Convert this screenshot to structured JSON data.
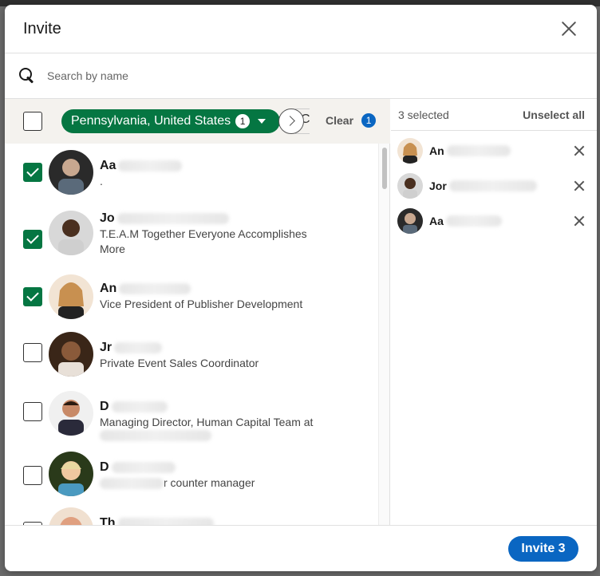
{
  "modal": {
    "title": "Invite"
  },
  "search": {
    "placeholder": "Search by name",
    "value": ""
  },
  "filter": {
    "location_label": "Pennsylvania, United States",
    "location_count": "1",
    "partial_label": "C",
    "clear_label": "Clear",
    "clear_count": "1"
  },
  "people": [
    {
      "name_visible": "Aa",
      "headline": ".",
      "checked": true,
      "avatar_color": "#3b3b3b"
    },
    {
      "name_visible": "Jo",
      "headline": "T.E.A.M Together Everyone Accomplishes",
      "headline2": "More",
      "checked": true,
      "avatar_color": "#5a4a40"
    },
    {
      "name_visible": "An",
      "headline": "Vice President of Publisher Development",
      "checked": true,
      "avatar_color": "#c89868"
    },
    {
      "name_visible": "Jr",
      "headline": "Private Event Sales Coordinator",
      "checked": false,
      "avatar_color": "#4a3020"
    },
    {
      "name_visible": "D",
      "headline": "Managing Director, Human Capital Team at",
      "checked": false,
      "avatar_color": "#6a4a3a"
    },
    {
      "name_visible": "D",
      "headline": "r counter manager",
      "checked": false,
      "avatar_color": "#d8b890"
    },
    {
      "name_visible": "Th",
      "headline": "",
      "checked": false,
      "avatar_color": "#e0a080"
    }
  ],
  "selected": {
    "count_label": "3 selected",
    "unselect_all_label": "Unselect all",
    "items": [
      {
        "name_visible": "An"
      },
      {
        "name_visible": "Jor"
      },
      {
        "name_visible": "Aa"
      }
    ]
  },
  "footer": {
    "invite_label": "Invite 3"
  },
  "colors": {
    "primary": "#0a66c2",
    "success": "#057642"
  }
}
